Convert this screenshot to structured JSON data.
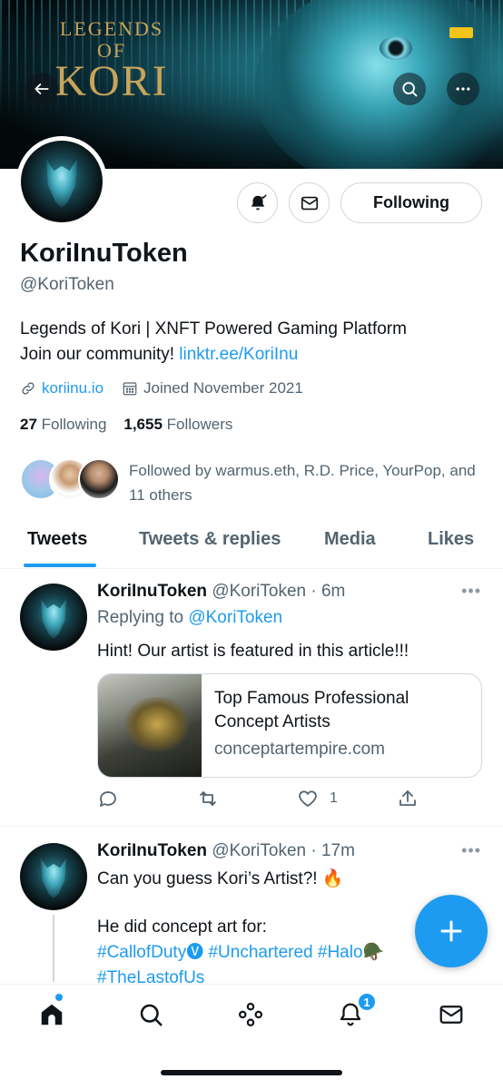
{
  "banner": {
    "logo_small": "LEGENDS OF",
    "logo_big": "KORI"
  },
  "profile": {
    "name": "KoriInuToken",
    "handle": "@KoriToken",
    "bio_line1": "Legends of Kori | XNFT Powered Gaming Platform",
    "bio_line2_prefix": "Join our community! ",
    "bio_link": "linktr.ee/KoriInu",
    "website": "koriinu.io",
    "joined": "Joined November 2021",
    "following_count": "27",
    "following_label": "Following",
    "followers_count": "1,655",
    "followers_label": "Followers",
    "followed_by": "Followed by warmus.eth, R.D. Price, YourPop, and 11 others",
    "following_button": "Following"
  },
  "tabs": [
    {
      "label": "Tweets",
      "active": true
    },
    {
      "label": "Tweets & replies",
      "active": false
    },
    {
      "label": "Media",
      "active": false
    },
    {
      "label": "Likes",
      "active": false
    }
  ],
  "tweets": [
    {
      "name": "KoriInuToken",
      "handle_time": "@KoriToken · 6m",
      "replying_prefix": "Replying to ",
      "replying_handle": "@KoriToken",
      "text": "Hint! Our artist is featured in this article!!!",
      "card_title": "Top Famous Professional Concept Artists",
      "card_domain": "conceptartempire.com",
      "like_count": "1"
    },
    {
      "name": "KoriInuToken",
      "handle_time": "@KoriToken · 17m",
      "text_line1": "Can you guess Kori’s Artist?! 🔥",
      "text_line2": "He did concept art for:",
      "hashtags": "#CallofDuty🅥 #Unchartered #Halo🪖 #TheLastofUs"
    }
  ],
  "nav": {
    "notification_badge": "1"
  },
  "colors": {
    "accent": "#1d9bf0",
    "text": "#0f1419",
    "muted": "#536471"
  }
}
